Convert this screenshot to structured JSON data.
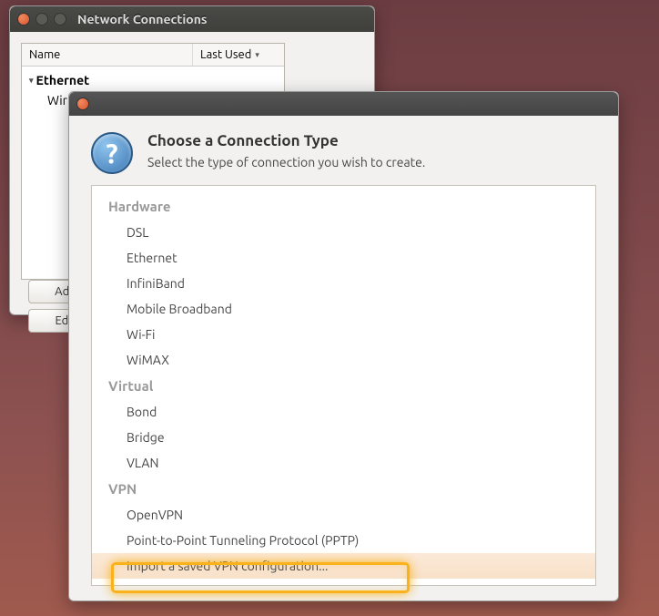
{
  "window1": {
    "title": "Network Connections",
    "cols": {
      "name": "Name",
      "lastused": "Last Used"
    },
    "tree": {
      "category": "Ethernet",
      "item": "Wir"
    },
    "buttons": {
      "add": "Add",
      "edit": "Edit"
    }
  },
  "dialog": {
    "title": "Choose a Connection Type",
    "subtitle": "Select the type of connection you wish to create.",
    "groups": {
      "hardware": "Hardware",
      "virtual": "Virtual",
      "vpn": "VPN"
    },
    "hardware_items": [
      "DSL",
      "Ethernet",
      "InfiniBand",
      "Mobile Broadband",
      "Wi-Fi",
      "WiMAX"
    ],
    "virtual_items": [
      "Bond",
      "Bridge",
      "VLAN"
    ],
    "vpn_items": [
      "OpenVPN",
      "Point-to-Point Tunneling Protocol (PPTP)"
    ],
    "vpn_selected": "Import a saved VPN configuration..."
  }
}
